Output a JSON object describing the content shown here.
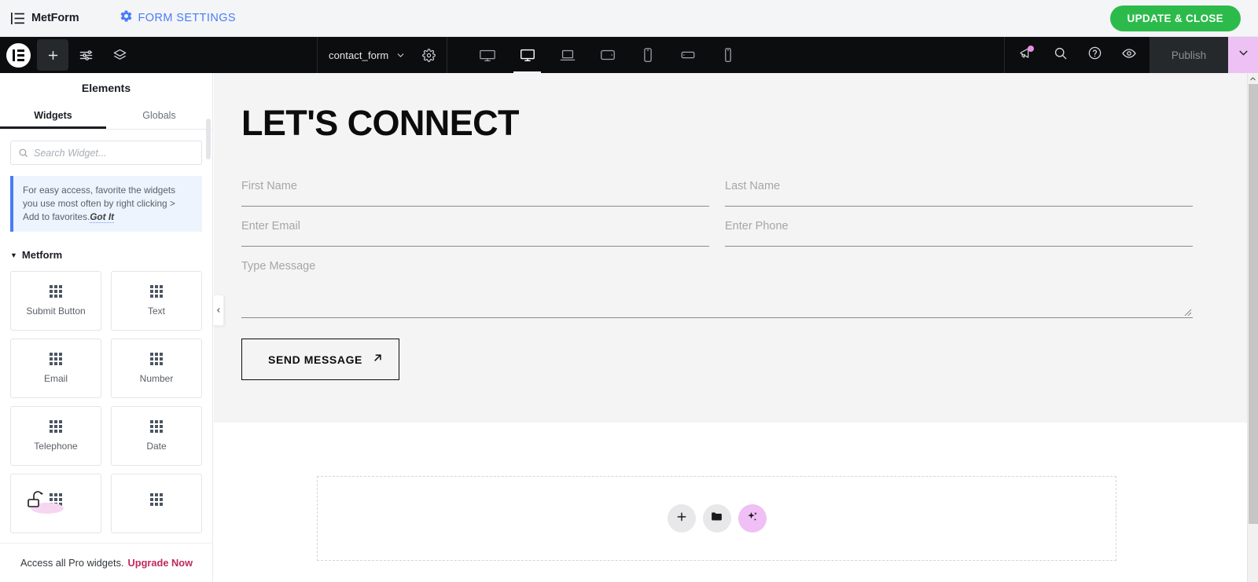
{
  "metform_bar": {
    "brand_icon": "list-lines-icon",
    "brand": "MetForm",
    "settings_icon": "gear-icon",
    "settings_label": "FORM SETTINGS",
    "update_close_label": "UPDATE & CLOSE",
    "update_close_color": "#2cbb4b",
    "link_color": "#4a7cf7"
  },
  "toolbar": {
    "logo_icon": "elementor-logo-icon",
    "add_icon": "plus-icon",
    "settings_icon": "sliders-icon",
    "navigator_icon": "layers-icon",
    "document_name": "contact_form",
    "document_caret_icon": "chevron-down-icon",
    "document_settings_icon": "gear-icon",
    "devices": [
      {
        "name": "widescreen",
        "icon": "monitor-wide-icon",
        "active": false
      },
      {
        "name": "desktop",
        "icon": "desktop-icon",
        "active": true
      },
      {
        "name": "laptop",
        "icon": "laptop-icon",
        "active": false
      },
      {
        "name": "tablet",
        "icon": "tablet-icon",
        "active": false
      },
      {
        "name": "mobile",
        "icon": "mobile-icon",
        "active": false
      },
      {
        "name": "tablet-landscape",
        "icon": "tablet-landscape-icon",
        "active": false
      },
      {
        "name": "mobile-extra",
        "icon": "mobile-extra-icon",
        "active": false
      }
    ],
    "whats_new_icon": "megaphone-icon",
    "whats_new_badge_color": "#e68fe6",
    "search_icon": "search-icon",
    "help_icon": "question-circle-icon",
    "preview_icon": "eye-icon",
    "publish_label": "Publish",
    "publish_caret_icon": "chevron-down-icon",
    "publish_caret_color": "#eec1f5"
  },
  "panel": {
    "title": "Elements",
    "tabs": [
      {
        "label": "Widgets",
        "active": true
      },
      {
        "label": "Globals",
        "active": false
      }
    ],
    "search": {
      "icon": "search-icon",
      "placeholder": "Search Widget...",
      "value": ""
    },
    "notice": {
      "text": "For easy access, favorite the widgets you use most often by right clicking > Add to favorites.",
      "action": "Got It",
      "accent": "#4a7cf7"
    },
    "category": {
      "caret_icon": "caret-down-icon",
      "name": "Metform"
    },
    "widgets": [
      {
        "label": "Submit Button",
        "icon": "grid-9-icon"
      },
      {
        "label": "Text",
        "icon": "grid-9-icon"
      },
      {
        "label": "Email",
        "icon": "grid-9-icon"
      },
      {
        "label": "Number",
        "icon": "grid-9-icon"
      },
      {
        "label": "Telephone",
        "icon": "grid-9-icon"
      },
      {
        "label": "Date",
        "icon": "grid-9-icon"
      },
      {
        "label": "",
        "icon": "grid-9-icon"
      },
      {
        "label": "",
        "icon": "grid-9-icon"
      }
    ],
    "footer": {
      "text": "Access all Pro widgets.",
      "link": "Upgrade Now",
      "link_color": "#c1285e"
    },
    "collapse_icon": "chevron-left-icon"
  },
  "canvas": {
    "heading": "LET'S CONNECT",
    "section_bg": "#f4f4f4",
    "fields": [
      {
        "name": "first-name",
        "placeholder": "First Name"
      },
      {
        "name": "last-name",
        "placeholder": "Last Name"
      },
      {
        "name": "email",
        "placeholder": "Enter Email"
      },
      {
        "name": "phone",
        "placeholder": "Enter Phone"
      }
    ],
    "message": {
      "name": "message",
      "placeholder": "Type Message"
    },
    "submit": {
      "label": "SEND MESSAGE",
      "icon": "arrow-up-right-icon"
    },
    "dropzone": {
      "add_icon": "plus-icon",
      "folder_icon": "folder-icon",
      "ai_icon": "sparkle-icon",
      "ai_color": "#f0bff5"
    }
  },
  "scrollbar": {
    "up_arrow_icon": "chevron-up-icon"
  }
}
